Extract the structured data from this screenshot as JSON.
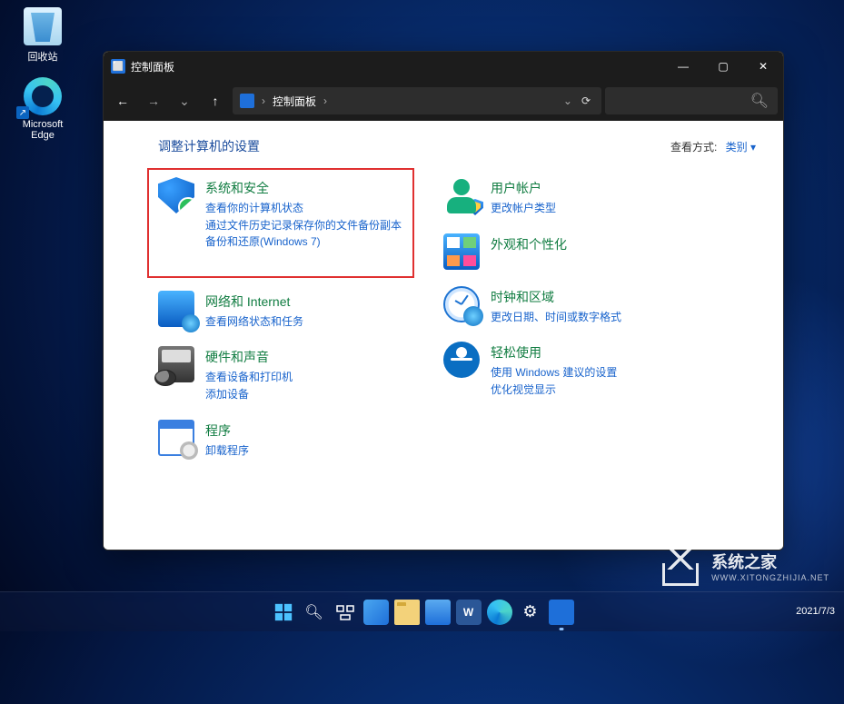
{
  "desktop": {
    "recycle_label": "回收站",
    "edge_label": "Microsoft Edge",
    "edge_badge": "↗"
  },
  "window": {
    "title": "控制面板",
    "breadcrumb_root": "控制面板"
  },
  "content": {
    "heading": "调整计算机的设置",
    "view_label": "查看方式:",
    "view_value": "类别 ▾"
  },
  "categories": {
    "security": {
      "name": "系统和安全",
      "links": [
        "查看你的计算机状态",
        "通过文件历史记录保存你的文件备份副本",
        "备份和还原(Windows 7)"
      ]
    },
    "network": {
      "name": "网络和 Internet",
      "links": [
        "查看网络状态和任务"
      ]
    },
    "hardware": {
      "name": "硬件和声音",
      "links": [
        "查看设备和打印机",
        "添加设备"
      ]
    },
    "programs": {
      "name": "程序",
      "links": [
        "卸载程序"
      ]
    },
    "user": {
      "name": "用户帐户",
      "links": [
        "更改帐户类型"
      ]
    },
    "appearance": {
      "name": "外观和个性化",
      "links": []
    },
    "clock": {
      "name": "时钟和区域",
      "links": [
        "更改日期、时间或数字格式"
      ]
    },
    "ease": {
      "name": "轻松使用",
      "links": [
        "使用 Windows 建议的设置",
        "优化视觉显示"
      ]
    }
  },
  "tray": {
    "date": "2021/7/3"
  },
  "watermark": {
    "text": "系统之家",
    "sub": "WWW.XITONGZHIJIA.NET"
  }
}
